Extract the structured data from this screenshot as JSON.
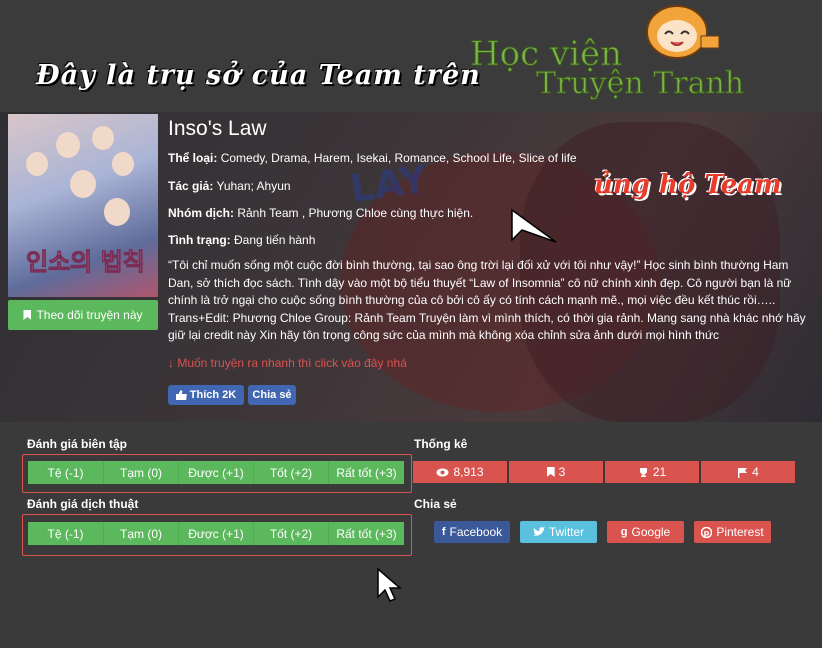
{
  "header": {
    "banner_text": "Đây là trụ sở của Team trên",
    "logo_line1": "Học viện",
    "logo_line2": "Truyện Tranh"
  },
  "hero": {
    "support_text": "ủng hộ Team",
    "bg_text": "LAY",
    "cover_title": "인소의 법칙",
    "follow_label": "Theo dõi truyện này",
    "title": "Inso's Law",
    "genres_label": "Thể loại:",
    "genres_value": "Comedy, Drama, Harem, Isekai, Romance, School Life, Slice of life",
    "author_label": "Tác giả:",
    "author_value": "Yuhan; Ahyun",
    "translator_label": "Nhóm dịch:",
    "translator_value": "Rảnh Team , Phương Chloe cùng thực hiện.",
    "status_label": "Tình trạng:",
    "status_value": "Đang tiến hành",
    "description": "“Tôi chỉ muốn sống một cuộc đời bình thường, tại sao ông trời lại đối xử với tôi như vậy!” Học sinh bình thường Ham Dan, sở thích đọc sách. Tình dậy vào một bộ tiểu thuyết “Law of Insomnia” cô nữ chính xinh đẹp. Cô người bạn là nữ chính là trở ngại cho cuộc sống bình thường của cô bởi cô ấy có tính cách mạnh mẽ., mọi việc đều kết thúc rồi….. Trans+Edit: Phương Chloe Group: Rảnh Team Truyện làm vì mình thích, có thời gia rảnh. Mang sang nhà khác nhớ hãy giữ lại credit này Xin hãy tôn trọng công sức của mình mà không xóa chỉnh sửa ảnh dưới mọi hình thức",
    "fast_link": "↓ Muốn truyện ra nhanh thì click vào đây nhá",
    "like_label": "Thích 2K",
    "share_label": "Chia sẻ"
  },
  "ratings": {
    "editor_label": "Đánh giá biên tập",
    "translation_label": "Đánh giá dịch thuật",
    "options": [
      "Tệ (-1)",
      "Tạm (0)",
      "Được (+1)",
      "Tốt (+2)",
      "Rất tốt (+3)"
    ]
  },
  "stats": {
    "label": "Thống kê",
    "views": "8,913",
    "bookmarks": "3",
    "trophies": "21",
    "flags": "4"
  },
  "share": {
    "label": "Chia sẻ",
    "facebook": "Facebook",
    "twitter": "Twitter",
    "google": "Google",
    "pinterest": "Pinterest"
  },
  "colors": {
    "green": "#5cb85c",
    "red": "#d9534f",
    "facebook": "#3b5998",
    "twitter": "#5bc0de",
    "google": "#d9534f",
    "pinterest": "#d9534f"
  }
}
